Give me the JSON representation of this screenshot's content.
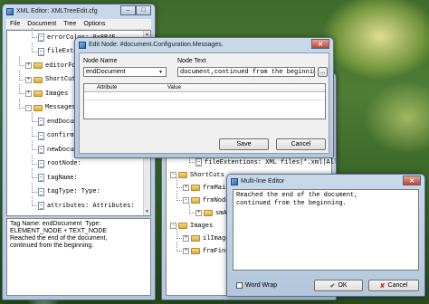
{
  "main_window": {
    "title": "XML Editor: XMLTreeEdit.cfg",
    "menu": [
      "File",
      "Document",
      "Tree",
      "Options"
    ],
    "tree": [
      {
        "text": "errorColor: 0x8B4F",
        "indent": 2,
        "icon": "doc"
      },
      {
        "text": "fileExtentions:",
        "indent": 2,
        "icon": "doc"
      },
      {
        "text": "editorFont:",
        "indent": 1,
        "icon": "folder",
        "toggle": "+"
      },
      {
        "text": "ShortCuts",
        "indent": 1,
        "icon": "folder",
        "toggle": "+"
      },
      {
        "text": "Images",
        "indent": 1,
        "icon": "folder",
        "toggle": "+"
      },
      {
        "text": "Messages",
        "indent": 1,
        "icon": "folder",
        "toggle": "-"
      },
      {
        "text": "endDocument:",
        "indent": 2,
        "icon": "doc",
        "selected": true
      },
      {
        "text": "confirmExit:",
        "indent": 2,
        "icon": "doc"
      },
      {
        "text": "newDocument:",
        "indent": 2,
        "icon": "doc"
      },
      {
        "text": "rootNode:",
        "indent": 2,
        "icon": "doc"
      },
      {
        "text": "tagName:",
        "indent": 2,
        "icon": "doc"
      },
      {
        "text": "tagType: Type:",
        "indent": 2,
        "icon": "doc"
      },
      {
        "text": "attributes: Attributes:",
        "indent": 2,
        "icon": "doc"
      }
    ],
    "status_text": "Tag Name: endDocument  Type: ELEMENT_NODE + TEXT_NODE\nReached the end of the document,\ncontinued from the beginning."
  },
  "back_window": {
    "tree": [
      {
        "text": "fileExtentions: XML files|*.xml|All Files|*.*|CFG files|*.cfg",
        "indent": 2,
        "icon": "doc"
      },
      {
        "text": "ShortCuts",
        "indent": 0,
        "icon": "folder",
        "toggle": "-"
      },
      {
        "text": "frmMain",
        "indent": 1,
        "icon": "folder",
        "toggle": "+"
      },
      {
        "text": "frmNode",
        "indent": 1,
        "icon": "folder",
        "toggle": "-"
      },
      {
        "text": "smAction",
        "indent": 2,
        "icon": "folder",
        "toggle": "+"
      },
      {
        "text": "Images",
        "indent": 0,
        "icon": "folder",
        "toggle": "-"
      },
      {
        "text": "ilImages",
        "indent": 1,
        "icon": "folder",
        "toggle": "+"
      },
      {
        "text": "frmFind",
        "indent": 1,
        "icon": "folder",
        "toggle": "+"
      }
    ]
  },
  "edit_dialog": {
    "title": "Edit Node: #document.Configuration.Messages.",
    "node_name_label": "Node Name",
    "node_name_value": "endDocument",
    "node_text_label": "Node Text",
    "node_text_value": "document,continued from the beginning.",
    "dots_label": "...",
    "col_attribute": "Attribute",
    "col_value": "Value",
    "save_label": "Save",
    "cancel_label": "Cancel"
  },
  "multiline_editor": {
    "title": "Multi-line Editor",
    "text": "Reached the end of the document,\ncontinued from the beginning.",
    "word_wrap_label": "Word Wrap",
    "ok_label": "OK",
    "cancel_label": "Cancel"
  },
  "window_buttons": {
    "min": "–",
    "max": "□",
    "close": "✕"
  }
}
